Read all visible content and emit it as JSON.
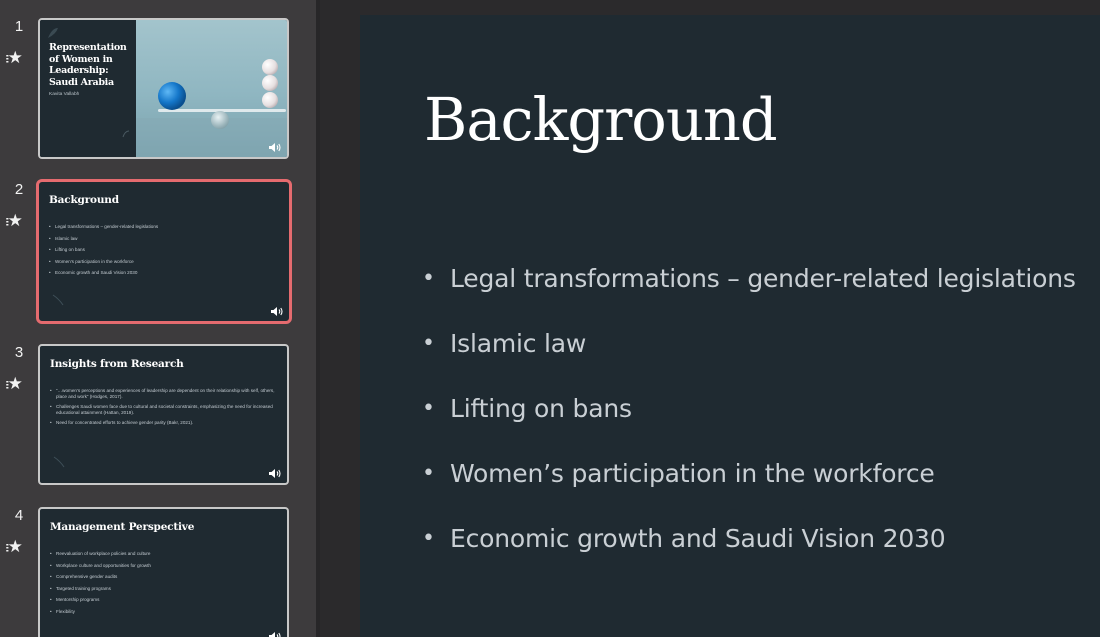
{
  "navigator": {
    "slides": [
      {
        "number": "1",
        "title": "Representation of Women in Leadership: Saudi Arabia",
        "author": "Kavita Vallabh"
      },
      {
        "number": "2",
        "title": "Background",
        "bullets": [
          "Legal transformations – gender-related legislations",
          "Islamic law",
          "Lifting on bans",
          "Women’s participation in the workforce",
          "Economic growth and Saudi Vision 2030"
        ]
      },
      {
        "number": "3",
        "title": "Insights from Research",
        "bullets": [
          "“…women’s perceptions and experiences of leadership are dependent on their relationship with self, others, place and work” (Hodges, 2017).",
          "Challenges Saudi women face due to cultural and societal constraints, emphasizing the need for increased educational attainment (Hattan, 2019).",
          "Need for concentrated efforts to achieve gender parity (Bakr, 2021)."
        ]
      },
      {
        "number": "4",
        "title": "Management Perspective",
        "bullets": [
          "Reevaluation of workplace policies and culture",
          "Workplace culture and opportunities for growth",
          "Comprehensive gender audits",
          "Targeted training programs",
          "Mentorship programs",
          "Flexibility"
        ]
      }
    ],
    "selected_index": 2,
    "accent_color": "#e56b6f"
  },
  "main_slide": {
    "title": "Background",
    "bullets": [
      "Legal transformations – gender-related legislations",
      "Islamic law",
      "Lifting on bans",
      "Women’s participation in the workforce",
      "Economic growth and Saudi Vision 2030"
    ],
    "background_color": "#1f2a31"
  },
  "icons": {
    "animation": "animation-star-icon",
    "audio": "speaker-audio-icon"
  }
}
